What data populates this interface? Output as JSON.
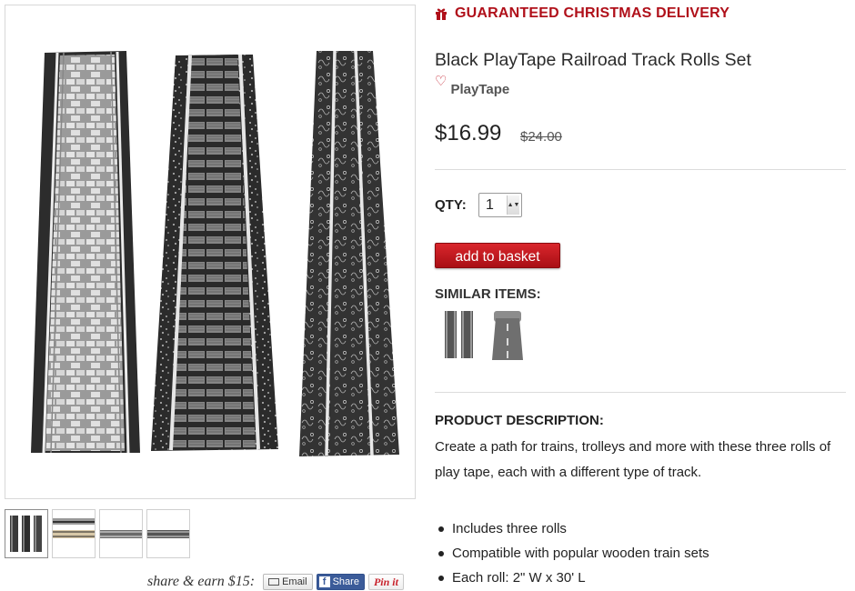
{
  "promo": {
    "icon": "gift-icon",
    "text": "GUARANTEED CHRISTMAS DELIVERY"
  },
  "product": {
    "title": "Black PlayTape Railroad Track Rolls Set",
    "brand": "PlayTape",
    "price": "$16.99",
    "old_price": "$24.00"
  },
  "quantity": {
    "label": "QTY:",
    "value": "1"
  },
  "basket_button": "add to basket",
  "similar": {
    "label": "SIMILAR ITEMS:"
  },
  "description": {
    "heading": "PRODUCT DESCRIPTION:",
    "text": "Create a path for trains, trolleys and more with these three rolls of play tape, each with a different type of track.",
    "bullets": [
      "Includes three rolls",
      "Compatible with popular wooden train sets",
      "Each roll: 2\" W x 30' L"
    ]
  },
  "share": {
    "label": "share & earn $15:",
    "email": "Email",
    "facebook": "Share",
    "pinterest": "Pin it"
  },
  "colors": {
    "accent_red": "#b0101a",
    "button_red": "#c41a21",
    "facebook_blue": "#3b5b99"
  }
}
